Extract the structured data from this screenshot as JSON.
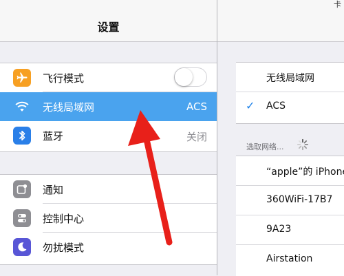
{
  "status_bar": {
    "device": "iPad"
  },
  "master": {
    "title": "设置",
    "group1": [
      {
        "label": "飞行模式",
        "icon": "airplane-icon",
        "icon_color": "#f7a023",
        "control": "toggle",
        "toggle_on": false
      },
      {
        "label": "无线局域网",
        "icon": "wifi-icon",
        "icon_color": "#4aa3ee",
        "value": "ACS",
        "selected": true
      },
      {
        "label": "蓝牙",
        "icon": "bluetooth-icon",
        "icon_color": "#2a7fe8",
        "value": "关闭"
      }
    ],
    "group2": [
      {
        "label": "通知",
        "icon": "notifications-icon",
        "icon_color": "#8e8e93"
      },
      {
        "label": "控制中心",
        "icon": "control-center-icon",
        "icon_color": "#8e8e93"
      },
      {
        "label": "勿扰模式",
        "icon": "moon-icon",
        "icon_color": "#5856d6"
      }
    ]
  },
  "detail": {
    "title_fragment": "卡",
    "wifi_row_label": "无线局域网",
    "connected_network": "ACS",
    "choose_network_label": "选取网络...",
    "networks": [
      "“apple”的 iPhone",
      "360WiFi-17B7",
      "9A23",
      "Airstation"
    ]
  },
  "colors": {
    "selection": "#4aa3ee",
    "accent": "#1a7fe8",
    "annotation_arrow": "#e8201a"
  }
}
